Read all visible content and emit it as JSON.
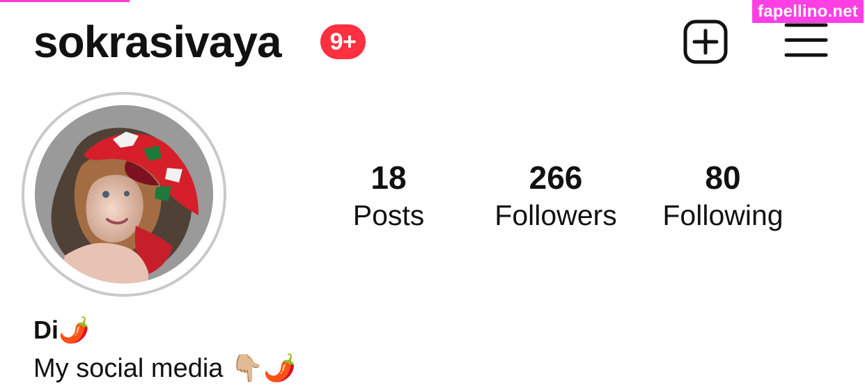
{
  "watermark": {
    "text": "fapellino.net"
  },
  "header": {
    "username": "sokrasivaya",
    "notification_badge": "9+",
    "new_post_icon": "plus-square-icon",
    "menu_icon": "hamburger-menu-icon"
  },
  "profile": {
    "avatar_icon": "profile-photo",
    "stats": [
      {
        "value": "18",
        "label": "Posts"
      },
      {
        "value": "266",
        "label": "Followers"
      },
      {
        "value": "80",
        "label": "Following"
      }
    ],
    "display_name": "Di🌶️",
    "bio": "My social media 👇🏼🌶️"
  },
  "colors": {
    "watermark": "#ff3fe4",
    "notification": "#ff3040",
    "avatar_ring": "#c9c9c9"
  }
}
